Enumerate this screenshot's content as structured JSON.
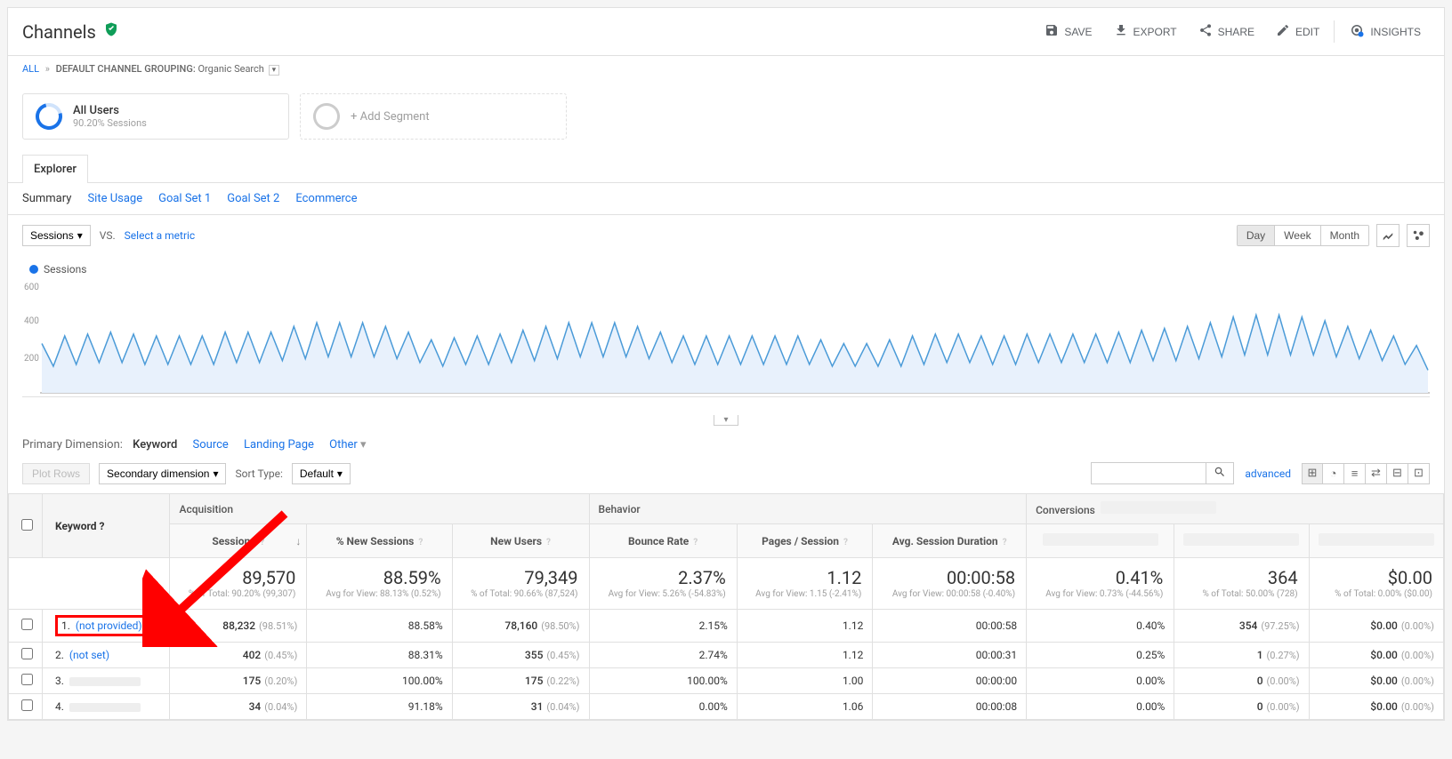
{
  "page_title": "Channels",
  "header_actions": {
    "save": "SAVE",
    "export": "EXPORT",
    "share": "SHARE",
    "edit": "EDIT",
    "insights": "INSIGHTS"
  },
  "breadcrumb": {
    "all": "ALL",
    "grouping_label": "DEFAULT CHANNEL GROUPING:",
    "grouping_value": "Organic Search"
  },
  "segments": {
    "primary_name": "All Users",
    "primary_meta": "90.20% Sessions",
    "add": "+ Add Segment"
  },
  "tab": "Explorer",
  "subtabs": {
    "summary": "Summary",
    "site_usage": "Site Usage",
    "goal1": "Goal Set 1",
    "goal2": "Goal Set 2",
    "ecommerce": "Ecommerce"
  },
  "chart": {
    "metric": "Sessions",
    "vs": "VS.",
    "select_metric": "Select a metric",
    "periods": {
      "day": "Day",
      "week": "Week",
      "month": "Month"
    },
    "legend": "Sessions",
    "y_ticks": [
      "600",
      "400",
      "200"
    ]
  },
  "chart_data": {
    "type": "line",
    "title": "Sessions",
    "ylabel": "Sessions",
    "ylim": [
      0,
      600
    ],
    "series": [
      {
        "name": "Sessions",
        "values": [
          260,
          140,
          300,
          150,
          310,
          160,
          320,
          160,
          310,
          150,
          300,
          150,
          300,
          150,
          300,
          150,
          320,
          160,
          320,
          160,
          320,
          170,
          350,
          180,
          370,
          190,
          370,
          190,
          370,
          190,
          350,
          180,
          320,
          160,
          280,
          140,
          290,
          150,
          300,
          150,
          310,
          160,
          330,
          170,
          350,
          180,
          370,
          190,
          370,
          190,
          370,
          190,
          350,
          180,
          320,
          160,
          300,
          150,
          300,
          150,
          300,
          150,
          300,
          150,
          300,
          150,
          300,
          150,
          280,
          140,
          260,
          140,
          260,
          140,
          280,
          140,
          300,
          150,
          310,
          160,
          310,
          160,
          300,
          150,
          300,
          150,
          310,
          160,
          310,
          160,
          310,
          160,
          310,
          160,
          320,
          160,
          330,
          170,
          340,
          170,
          350,
          180,
          370,
          190,
          400,
          200,
          410,
          200,
          410,
          200,
          400,
          200,
          380,
          190,
          350,
          180,
          330,
          170,
          300,
          150,
          250,
          120
        ]
      }
    ]
  },
  "dimensions": {
    "label": "Primary Dimension:",
    "keyword": "Keyword",
    "source": "Source",
    "landing": "Landing Page",
    "other": "Other"
  },
  "table_controls": {
    "plot_rows": "Plot Rows",
    "secondary": "Secondary dimension",
    "sort_type": "Sort Type:",
    "default": "Default",
    "advanced": "advanced"
  },
  "table": {
    "keyword_header": "Keyword",
    "groups": {
      "acquisition": "Acquisition",
      "behavior": "Behavior",
      "conversions": "Conversions"
    },
    "cols": {
      "sessions": "Sessions",
      "pct_new": "% New Sessions",
      "new_users": "New Users",
      "bounce": "Bounce Rate",
      "pages": "Pages / Session",
      "duration": "Avg. Session Duration"
    },
    "totals": {
      "sessions": {
        "v": "89,570",
        "s": "% of Total: 90.20% (99,307)"
      },
      "pct_new": {
        "v": "88.59%",
        "s": "Avg for View: 88.13% (0.52%)"
      },
      "new_users": {
        "v": "79,349",
        "s": "% of Total: 90.66% (87,524)"
      },
      "bounce": {
        "v": "2.37%",
        "s": "Avg for View: 5.26% (-54.83%)"
      },
      "pages": {
        "v": "1.12",
        "s": "Avg for View: 1.15 (-2.41%)"
      },
      "duration": {
        "v": "00:00:58",
        "s": "Avg for View: 00:00:58 (-0.40%)"
      },
      "conv1": {
        "v": "0.41%",
        "s": "Avg for View: 0.73% (-44.56%)"
      },
      "conv2": {
        "v": "364",
        "s": "% of Total: 50.00% (728)"
      },
      "conv3": {
        "v": "$0.00",
        "s": "% of Total: 0.00% ($0.00)"
      }
    },
    "rows": [
      {
        "n": "1.",
        "kw": "(not provided)",
        "highlight": true,
        "sessions": "88,232",
        "sessions_pct": "(98.51%)",
        "pct_new": "88.58%",
        "new_users": "78,160",
        "new_users_pct": "(98.50%)",
        "bounce": "2.15%",
        "pages": "1.12",
        "duration": "00:00:58",
        "c1": "0.40%",
        "c2": "354",
        "c2_pct": "(97.25%)",
        "c3": "$0.00",
        "c3_pct": "(0.00%)"
      },
      {
        "n": "2.",
        "kw": "(not set)",
        "sessions": "402",
        "sessions_pct": "(0.45%)",
        "pct_new": "88.31%",
        "new_users": "355",
        "new_users_pct": "(0.45%)",
        "bounce": "2.74%",
        "pages": "1.12",
        "duration": "00:00:31",
        "c1": "0.25%",
        "c2": "1",
        "c2_pct": "(0.27%)",
        "c3": "$0.00",
        "c3_pct": "(0.00%)"
      },
      {
        "n": "3.",
        "blurred": true,
        "sessions": "175",
        "sessions_pct": "(0.20%)",
        "pct_new": "100.00%",
        "new_users": "175",
        "new_users_pct": "(0.22%)",
        "bounce": "100.00%",
        "pages": "1.00",
        "duration": "00:00:00",
        "c1": "0.00%",
        "c2": "0",
        "c2_pct": "(0.00%)",
        "c3": "$0.00",
        "c3_pct": "(0.00%)"
      },
      {
        "n": "4.",
        "blurred": true,
        "sessions": "34",
        "sessions_pct": "(0.04%)",
        "pct_new": "91.18%",
        "new_users": "31",
        "new_users_pct": "(0.04%)",
        "bounce": "0.00%",
        "pages": "1.06",
        "duration": "00:00:08",
        "c1": "0.00%",
        "c2": "0",
        "c2_pct": "(0.00%)",
        "c3": "$0.00",
        "c3_pct": "(0.00%)"
      }
    ]
  }
}
